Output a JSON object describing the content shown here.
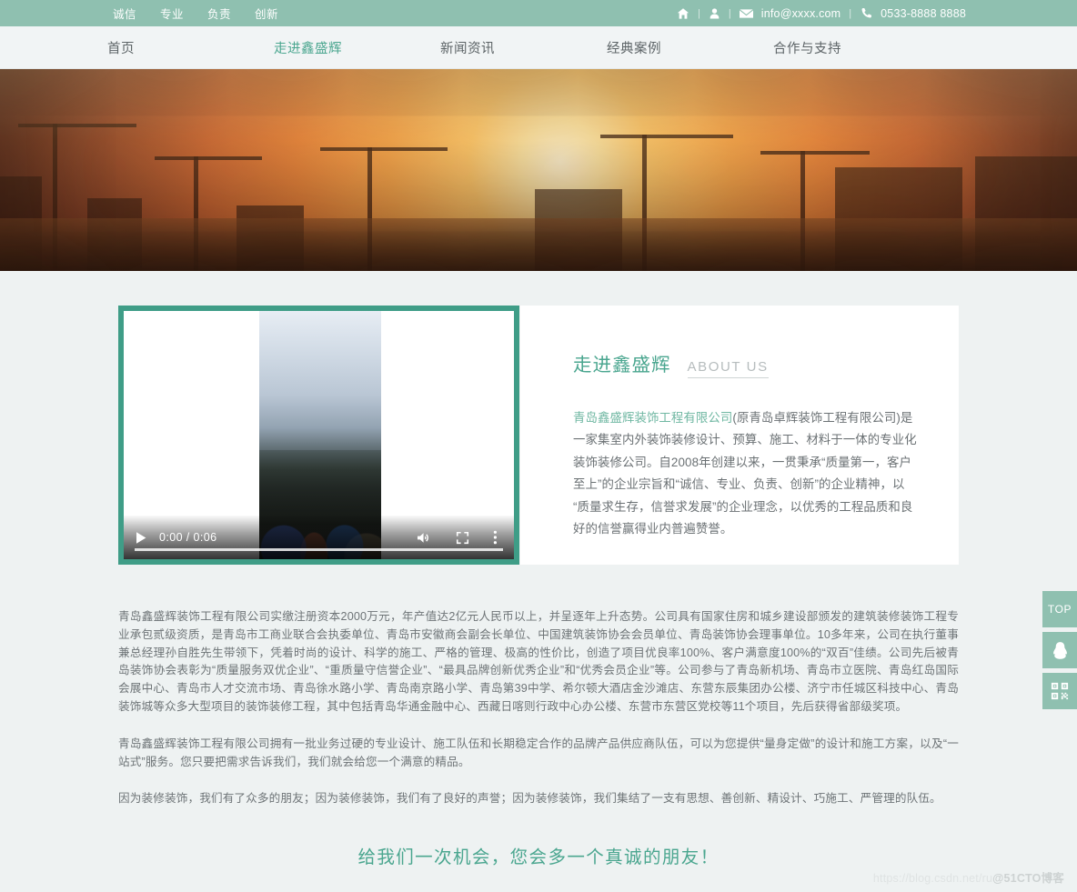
{
  "topbar": {
    "slogans": [
      "诚信",
      "专业",
      "负责",
      "创新"
    ],
    "separator": "|",
    "home_icon": "home-icon",
    "user_icon": "user-icon",
    "mail_icon": "mail-icon",
    "email": "info@xxxx.com",
    "phone_icon": "phone-icon",
    "phone": "0533-8888 8888",
    "bg_color": "#8fc0b0"
  },
  "nav": {
    "items": [
      {
        "label": "首页",
        "active": false
      },
      {
        "label": "走进鑫盛辉",
        "active": true
      },
      {
        "label": "新闻资讯",
        "active": false
      },
      {
        "label": "经典案例",
        "active": false
      },
      {
        "label": "合作与支持",
        "active": false
      }
    ],
    "active_color": "#4aa68f"
  },
  "video": {
    "play_icon": "play-icon",
    "time": "0:00 / 0:06",
    "volume_icon": "volume-icon",
    "fullscreen_icon": "fullscreen-icon",
    "more_icon": "more-options-icon",
    "border_color": "#3f9d87"
  },
  "about": {
    "title_cn": "走进鑫盛辉",
    "title_en": "ABOUT US",
    "highlight": "青岛鑫盛辉装饰工程有限公司",
    "body": "(原青岛卓辉装饰工程有限公司)是一家集室内外装饰装修设计、预算、施工、材料于一体的专业化装饰装修公司。自2008年创建以来，一贯秉承“质量第一，客户至上”的企业宗旨和“诚信、专业、负责、创新”的企业精神，以“质量求生存，信誉求发展”的企业理念，以优秀的工程品质和良好的信誉赢得业内普遍赞誉。",
    "accent_color": "#4aa68f"
  },
  "copy": {
    "paragraphs": [
      "青岛鑫盛辉装饰工程有限公司实缴注册资本2000万元，年产值达2亿元人民币以上，并呈逐年上升态势。公司具有国家住房和城乡建设部颁发的建筑装修装饰工程专业承包贰级资质，是青岛市工商业联合会执委单位、青岛市安徽商会副会长单位、中国建筑装饰协会会员单位、青岛装饰协会理事单位。10多年来，公司在执行董事兼总经理孙自胜先生带领下，凭着时尚的设计、科学的施工、严格的管理、极高的性价比，创造了项目优良率100%、客户满意度100%的“双百”佳绩。公司先后被青岛装饰协会表彰为“质量服务双优企业”、“重质量守信誉企业”、“最具品牌创新优秀企业”和“优秀会员企业”等。公司参与了青岛新机场、青岛市立医院、青岛红岛国际会展中心、青岛市人才交流市场、青岛徐水路小学、青岛南京路小学、青岛第39中学、希尔顿大酒店金沙滩店、东营东辰集团办公楼、济宁市任城区科技中心、青岛装饰城等众多大型项目的装饰装修工程，其中包括青岛华通金融中心、西藏日喀则行政中心办公楼、东营市东营区党校等11个项目，先后获得省部级奖项。",
      "青岛鑫盛辉装饰工程有限公司拥有一批业务过硬的专业设计、施工队伍和长期稳定合作的品牌产品供应商队伍，可以为您提供“量身定做”的设计和施工方案，以及“一站式”服务。您只要把需求告诉我们，我们就会给您一个满意的精品。",
      "因为装修装饰，我们有了众多的朋友；因为装修装饰，我们有了良好的声誉；因为装修装饰，我们集结了一支有思想、善创新、精设计、巧施工、严管理的队伍。"
    ],
    "slogan": "给我们一次机会，您会多一个真诚的朋友！"
  },
  "side_widgets": [
    {
      "name": "back-to-top",
      "label": "TOP",
      "icon": ""
    },
    {
      "name": "qq-contact",
      "label": "",
      "icon": "qq-penguin-icon"
    },
    {
      "name": "qrcode",
      "label": "",
      "icon": "qrcode-icon"
    }
  ],
  "watermark": {
    "url": "https://blog.csdn.net/ru",
    "brand": "@51CTO博客"
  }
}
